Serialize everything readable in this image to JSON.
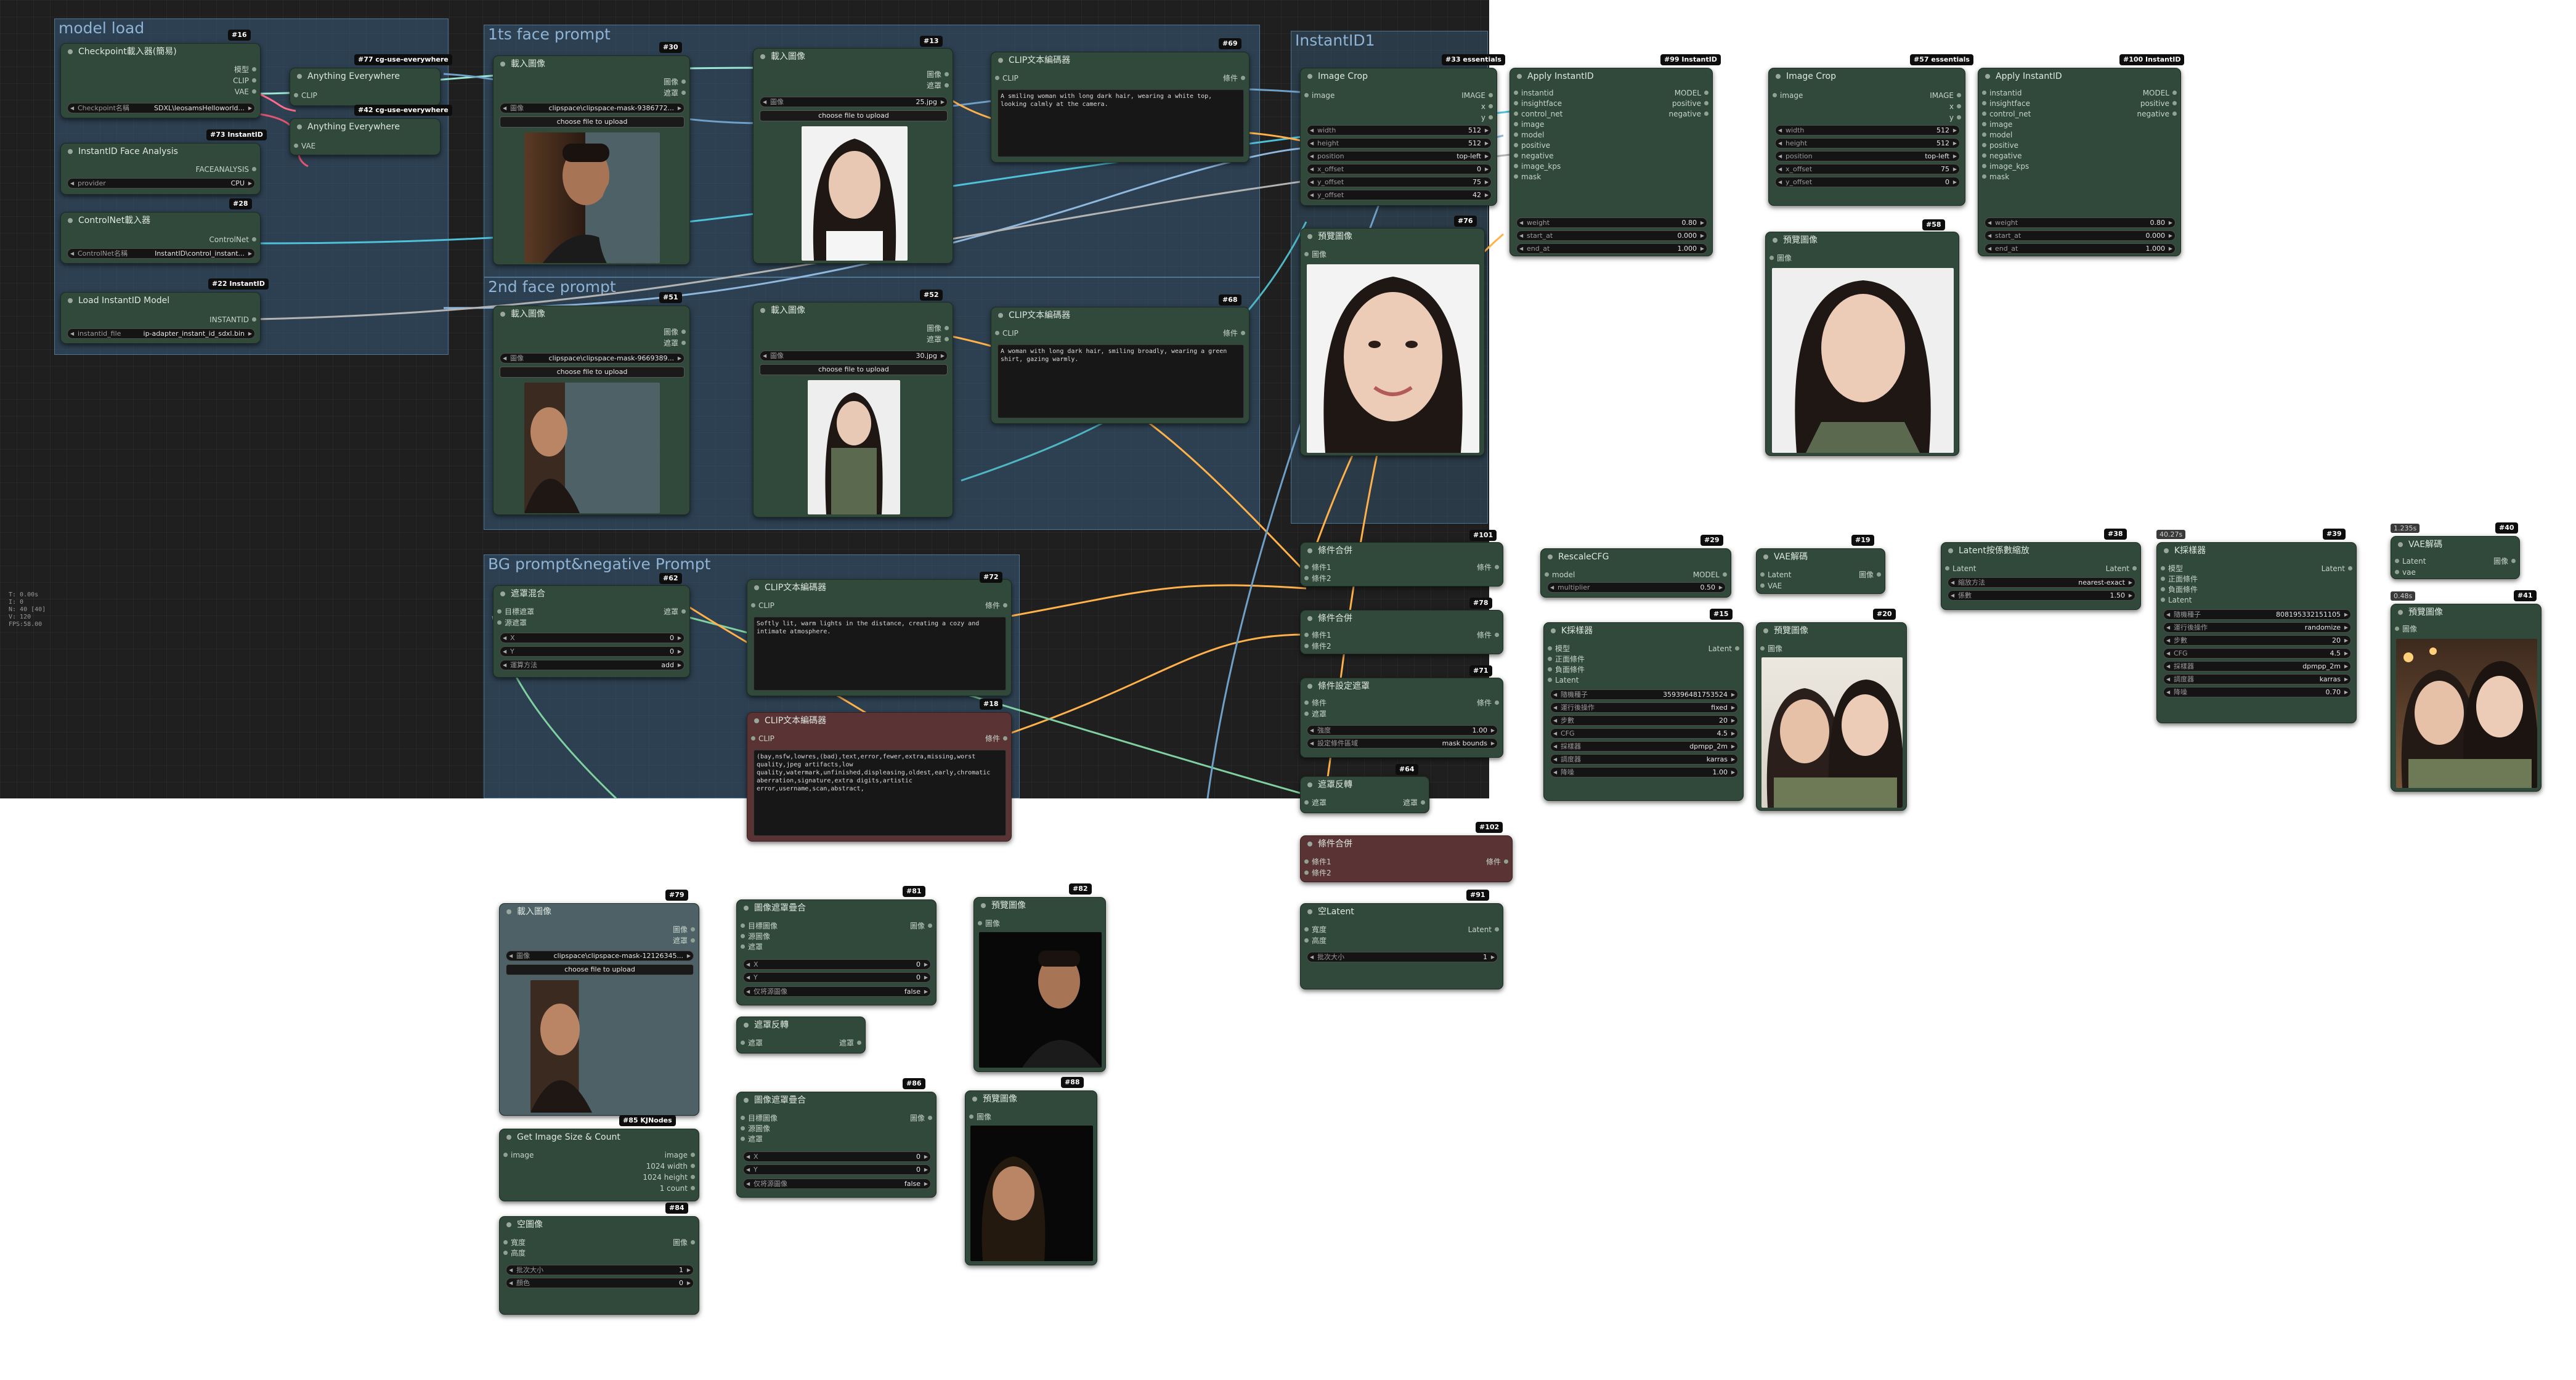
{
  "canvas_stats": [
    "T: 0.00s",
    "I: 0",
    "N: 40 [40]",
    "V: 120",
    "FPS:58.00"
  ],
  "groups": {
    "model_load": "model load",
    "face1": "1ts face prompt",
    "face2": "2nd face prompt",
    "bg": "BG prompt&negative Prompt",
    "instantid": "InstantID1"
  },
  "nodes": {
    "checkpoint": {
      "title": "Checkpoint載入器(簡易)",
      "badge": "#16",
      "out1": "模型",
      "out2": "CLIP",
      "out3": "VAE",
      "w_label": "Checkpoint名稱",
      "w_value": "SDXL\\leosamsHelloworld..."
    },
    "anything1": {
      "title": "Anything Everywhere",
      "badge": "#77 cg-use-everywhere",
      "in1": "CLIP"
    },
    "anything2": {
      "title": "Anything Everywhere",
      "badge": "#42 cg-use-everywhere",
      "in1": "VAE"
    },
    "faceanalysis": {
      "title": "InstantID Face Analysis",
      "badge": "#73 InstantID",
      "out1": "FACEANALYSIS",
      "w_label": "provider",
      "w_value": "CPU"
    },
    "controlnet": {
      "title": "ControlNet載入器",
      "badge": "#28",
      "out1": "ControlNet",
      "w_label": "ControlNet名稱",
      "w_value": "InstantID\\control_instant..."
    },
    "loadinstantid": {
      "title": "Load InstantID Model",
      "badge": "#22 InstantID",
      "out1": "INSTANTID",
      "w_label": "instantid_file",
      "w_value": "ip-adapter_instant_id_sdxl.bin"
    },
    "load30": {
      "title": "載入圖像",
      "badge": "#30",
      "out1": "圖像",
      "out2": "遮罩",
      "w_label": "圖像",
      "w_value": "clipspace\\clipspace-mask-9386772...",
      "button": "choose file to upload"
    },
    "load13": {
      "title": "載入圖像",
      "badge": "#13",
      "out1": "圖像",
      "out2": "遮罩",
      "w_label": "圖像",
      "w_value": "25.jpg",
      "button": "choose file to upload"
    },
    "clip69": {
      "title": "CLIP文本編碼器",
      "badge": "#69",
      "in1": "CLIP",
      "out1": "條件",
      "text": "A smiling woman with long dark hair, wearing a white top, looking calmly at the camera."
    },
    "load51": {
      "title": "載入圖像",
      "badge": "#51",
      "out1": "圖像",
      "out2": "遮罩",
      "w_label": "圖像",
      "w_value": "clipspace\\clipspace-mask-9669389...",
      "button": "choose file to upload"
    },
    "load52": {
      "title": "載入圖像",
      "badge": "#52",
      "out1": "圖像",
      "out2": "遮罩",
      "w_label": "圖像",
      "w_value": "30.jpg",
      "button": "choose file to upload"
    },
    "clip68": {
      "title": "CLIP文本編碼器",
      "badge": "#68",
      "in1": "CLIP",
      "out1": "條件",
      "text": "A woman with long dark hair, smiling broadly, wearing a green shirt, gazing warmly."
    },
    "mask62": {
      "title": "遮罩混合",
      "badge": "#62",
      "in1": "目標遮罩",
      "in2": "源遮罩",
      "out1": "遮罩",
      "w1_label": "X",
      "w1_value": "0",
      "w2_label": "Y",
      "w2_value": "0",
      "w3_label": "運算方法",
      "w3_value": "add"
    },
    "clip72": {
      "title": "CLIP文本編碼器",
      "badge": "#72",
      "in1": "CLIP",
      "out1": "條件",
      "text": "Softly lit, warm lights in the distance, creating a cozy and intimate atmosphere."
    },
    "clip18": {
      "title": "CLIP文本編碼器",
      "badge": "#18",
      "in1": "CLIP",
      "out1": "條件",
      "text": "(bay,nsfw,lowres,(bad),text,error,fewer,extra,missing,worst quality,jpeg artifacts,low quality,watermark,unfinished,displeasing,oldest,early,chromatic aberration,signature,extra digits,artistic error,username,scan,abstract,"
    },
    "crop33": {
      "title": "Image Crop",
      "badge": "#33 essentials",
      "in1": "image",
      "out1": "IMAGE",
      "out2": "x",
      "out3": "y",
      "w": [
        [
          "width",
          "512"
        ],
        [
          "height",
          "512"
        ],
        [
          "position",
          "top-left"
        ],
        [
          "x_offset",
          "0"
        ],
        [
          "y_offset",
          "75"
        ],
        [
          "y_offset",
          "42"
        ]
      ]
    },
    "apply99": {
      "title": "Apply InstantID",
      "badge": "#99 InstantID",
      "ins": [
        "instantid",
        "insightface",
        "control_net",
        "image",
        "model",
        "positive",
        "negative",
        "image_kps",
        "mask"
      ],
      "outs": [
        "MODEL",
        "positive",
        "negative"
      ],
      "w": [
        [
          "weight",
          "0.80"
        ],
        [
          "start_at",
          "0.000"
        ],
        [
          "end_at",
          "1.000"
        ]
      ]
    },
    "crop57": {
      "title": "Image Crop",
      "badge": "#57 essentials",
      "in1": "image",
      "out1": "IMAGE",
      "out2": "x",
      "out3": "y",
      "w": [
        [
          "width",
          "512"
        ],
        [
          "height",
          "512"
        ],
        [
          "position",
          "top-left"
        ],
        [
          "x_offset",
          "75"
        ],
        [
          "y_offset",
          "0"
        ]
      ]
    },
    "apply100": {
      "title": "Apply InstantID",
      "badge": "#100 InstantID",
      "ins": [
        "instantid",
        "insightface",
        "control_net",
        "image",
        "model",
        "positive",
        "negative",
        "image_kps",
        "mask"
      ],
      "outs": [
        "MODEL",
        "positive",
        "negative"
      ],
      "w": [
        [
          "weight",
          "0.80"
        ],
        [
          "start_at",
          "0.000"
        ],
        [
          "end_at",
          "1.000"
        ]
      ]
    },
    "preview76": {
      "title": "預覽圖像",
      "badge": "#76",
      "in1": "圖像"
    },
    "preview58": {
      "title": "預覽圖像",
      "badge": "#58",
      "in1": "圖像"
    },
    "cond101": {
      "title": "條件合併",
      "badge": "#101",
      "in1": "條件1",
      "in2": "條件2",
      "out1": "條件"
    },
    "cond78": {
      "title": "條件合併",
      "badge": "#78",
      "in1": "條件1",
      "in2": "條件2",
      "out1": "條件"
    },
    "cond71": {
      "title": "條件設定遮罩",
      "badge": "#71",
      "in1": "條件",
      "in2": "遮罩",
      "out1": "條件",
      "w": [
        [
          "強度",
          "1.00"
        ],
        [
          "設定條件區域",
          "mask bounds"
        ]
      ]
    },
    "mask64": {
      "title": "遮罩反轉",
      "badge": "#64",
      "in1": "遮罩",
      "out1": "遮罩"
    },
    "cond102": {
      "title": "條件合併",
      "badge": "#102",
      "in1": "條件1",
      "in2": "條件2",
      "out1": "條件"
    },
    "latent91": {
      "title": "空Latent",
      "badge": "#91",
      "in1": "寬度",
      "in2": "高度",
      "out1": "Latent",
      "w": [
        [
          "批次大小",
          "1"
        ]
      ]
    },
    "rescale29": {
      "title": "RescaleCFG",
      "badge": "#29",
      "in1": "model",
      "out1": "MODEL",
      "w": [
        [
          "multiplier",
          "0.50"
        ]
      ]
    },
    "ksampler15": {
      "title": "K採樣器",
      "badge": "#15",
      "ins": [
        "模型",
        "正面條件",
        "負面條件",
        "Latent"
      ],
      "out1": "Latent",
      "w": [
        [
          "隨機種子",
          "359396481753524"
        ],
        [
          "運行後操作",
          "fixed"
        ],
        [
          "步數",
          "20"
        ],
        [
          "CFG",
          "4.5"
        ],
        [
          "採樣器",
          "dpmpp_2m"
        ],
        [
          "調度器",
          "karras"
        ],
        [
          "降噪",
          "1.00"
        ]
      ]
    },
    "vae19": {
      "title": "VAE解碼",
      "badge": "#19",
      "in1": "Latent",
      "in2": "VAE",
      "out1": "圖像"
    },
    "preview20": {
      "title": "預覽圖像",
      "badge": "#20",
      "in1": "圖像"
    },
    "latentscale38": {
      "title": "Latent按係數縮放",
      "badge": "#38",
      "in1": "Latent",
      "out1": "Latent",
      "w": [
        [
          "縮放方法",
          "nearest-exact"
        ],
        [
          "係數",
          "1.50"
        ]
      ]
    },
    "ksampler39": {
      "title": "K採樣器",
      "badge": "#39",
      "size": "40.27s",
      "ins": [
        "模型",
        "正面條件",
        "負面條件",
        "Latent"
      ],
      "out1": "Latent",
      "w": [
        [
          "隨機種子",
          "808195332151105"
        ],
        [
          "運行後操作",
          "randomize"
        ],
        [
          "步數",
          "20"
        ],
        [
          "CFG",
          "4.5"
        ],
        [
          "採樣器",
          "dpmpp_2m"
        ],
        [
          "調度器",
          "karras"
        ],
        [
          "降噪",
          "0.70"
        ]
      ]
    },
    "vae40": {
      "title": "VAE解碼",
      "badge": "#40",
      "size": "1.235s",
      "in1": "Latent",
      "in2": "vae",
      "out1": "圖像"
    },
    "preview41": {
      "title": "預覽圖像",
      "badge": "#41",
      "size": "0.48s",
      "in1": "圖像"
    },
    "load79": {
      "title": "載入圖像",
      "badge": "#79",
      "out1": "圖像",
      "out2": "遮罩",
      "w_label": "圖像",
      "w_value": "clipspace\\clipspace-mask-12126345...",
      "button": "choose file to upload"
    },
    "composite81": {
      "title": "圖像遮罩疊合",
      "badge": "#81",
      "ins": [
        "目標圖像",
        "源圖像",
        "遮罩"
      ],
      "out1": "圖像",
      "w": [
        [
          "X",
          "0"
        ],
        [
          "Y",
          "0"
        ]
      ],
      "toggle": "仅将源圖像",
      "toggle_value": "false"
    },
    "invert": {
      "title": "遮罩反轉",
      "in1": "遮罩",
      "out1": "遮罩"
    },
    "preview82": {
      "title": "預覽圖像",
      "badge": "#82",
      "in1": "圖像"
    },
    "composite86": {
      "title": "圖像遮罩疊合",
      "badge": "#86",
      "ins": [
        "目標圖像",
        "源圖像",
        "遮罩"
      ],
      "out1": "圖像",
      "w": [
        [
          "X",
          "0"
        ],
        [
          "Y",
          "0"
        ]
      ],
      "toggle": "仅将源圖像",
      "toggle_value": "false"
    },
    "preview88": {
      "title": "預覽圖像",
      "badge": "#88",
      "in1": "圖像"
    },
    "getsize85": {
      "title": "Get Image Size & Count",
      "badge": "#85 KJNodes",
      "in1": "image",
      "out1": "image",
      "out2": "1024 width",
      "out3": "1024 height",
      "out4": "1 count"
    },
    "empty84": {
      "title": "空圖像",
      "badge": "#84",
      "ins": [
        "寬度",
        "高度"
      ],
      "out1": "圖像",
      "w": [
        [
          "批次大小",
          "1"
        ],
        [
          "顏色",
          "0"
        ]
      ]
    }
  }
}
